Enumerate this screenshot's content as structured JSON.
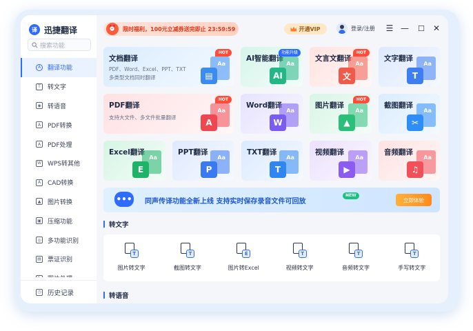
{
  "app": {
    "name": "迅捷翻译",
    "logo_mark": "译"
  },
  "search": {
    "placeholder": "搜索功能"
  },
  "sidebar": {
    "items": [
      {
        "label": "翻译功能",
        "icon": "translate-icon",
        "glyph": "A",
        "active": true
      },
      {
        "label": "转文字",
        "icon": "text-icon",
        "glyph": "T"
      },
      {
        "label": "转语音",
        "icon": "voice-icon",
        "glyph": "◉"
      },
      {
        "label": "PDF转换",
        "icon": "pdf-convert-icon",
        "glyph": "A"
      },
      {
        "label": "PDF处理",
        "icon": "pdf-process-icon",
        "glyph": "A"
      },
      {
        "label": "WPS转其他",
        "icon": "wps-icon",
        "glyph": "W"
      },
      {
        "label": "CAD转换",
        "icon": "cad-icon",
        "glyph": "A"
      },
      {
        "label": "图片转换",
        "icon": "image-convert-icon",
        "glyph": "▲"
      },
      {
        "label": "压缩功能",
        "icon": "compress-icon",
        "glyph": "▣"
      },
      {
        "label": "多功能识别",
        "icon": "recognize-icon",
        "glyph": "◎"
      },
      {
        "label": "票证识别",
        "icon": "ticket-icon",
        "glyph": "▤"
      },
      {
        "label": "图片处理",
        "icon": "image-process-icon",
        "glyph": "✎"
      }
    ],
    "history_label": "历史记录"
  },
  "header": {
    "promo_text": "限时福利，100元立减券送完即止 23:59:59",
    "vip_label": "开通VIP",
    "login_label": "登录/注册"
  },
  "cards": [
    {
      "title": "文档翻译",
      "desc": [
        "PDF、Word、Excel、PPT、TXT",
        "多类型文档同时翻译"
      ],
      "badge": "HOT",
      "glyph": "▤",
      "bg": "#d9ecff",
      "accent": "#3c8cf0"
    },
    {
      "title": "AI智能翻译",
      "badge": "功能升级",
      "glyph": "AI",
      "bg": "#d5f5ea",
      "accent": "#22b784"
    },
    {
      "title": "文言文翻译",
      "badge": "HOT",
      "glyph": "文",
      "bg": "#ffe3e0",
      "accent": "#f05a4a"
    },
    {
      "title": "文字翻译",
      "glyph": "T",
      "bg": "#dde9ff",
      "accent": "#3f7ef0"
    },
    {
      "title": "PDF翻译",
      "desc": [
        "支持大文件、多文件批量翻译"
      ],
      "badge": "HOT",
      "glyph": "A",
      "bg": "#ffe1e3",
      "accent": "#f0464f"
    },
    {
      "title": "Word翻译",
      "glyph": "W",
      "bg": "#e6e2ff",
      "accent": "#7a5cf0"
    },
    {
      "title": "图片翻译",
      "badge": "HOT",
      "glyph": "▲",
      "bg": "#d8f5e6",
      "accent": "#2cbf7a"
    },
    {
      "title": "截图翻译",
      "glyph": "✂",
      "bg": "#d9ecff",
      "accent": "#2f8ef5"
    },
    {
      "title": "Excel翻译",
      "glyph": "E",
      "bg": "#d6f5e4",
      "accent": "#1fb36a"
    },
    {
      "title": "PPT翻译",
      "glyph": "P",
      "bg": "#dfe9ff",
      "accent": "#3a7af0"
    },
    {
      "title": "TXT翻译",
      "glyph": "T",
      "bg": "#dbeaff",
      "accent": "#2f86f0"
    },
    {
      "title": "视频翻译",
      "glyph": "▶",
      "bg": "#ece1ff",
      "accent": "#8a5cf0"
    },
    {
      "title": "音频翻译",
      "glyph": "♫",
      "bg": "#ffe2e2",
      "accent": "#f0505a"
    }
  ],
  "card_illustration_text": "Aa",
  "banner": {
    "text": "同声传译功能全新上线  支持实时保存录音文件可回放",
    "badge": "NEW",
    "button": "立即体验"
  },
  "sections": {
    "speech_to_text": "转文字",
    "text_to_speech": "转语音"
  },
  "tools": [
    {
      "label": "图片转文字",
      "glyph": "T",
      "icon": "image-to-text-icon"
    },
    {
      "label": "截图转文字",
      "glyph": "T",
      "icon": "screenshot-to-text-icon"
    },
    {
      "label": "图片转Excel",
      "glyph": "E",
      "icon": "image-to-excel-icon"
    },
    {
      "label": "视频转文字",
      "glyph": "T",
      "icon": "video-to-text-icon"
    },
    {
      "label": "音频转文字",
      "glyph": "T",
      "icon": "audio-to-text-icon"
    },
    {
      "label": "手写转文字",
      "glyph": "T",
      "icon": "handwriting-to-text-icon"
    }
  ]
}
